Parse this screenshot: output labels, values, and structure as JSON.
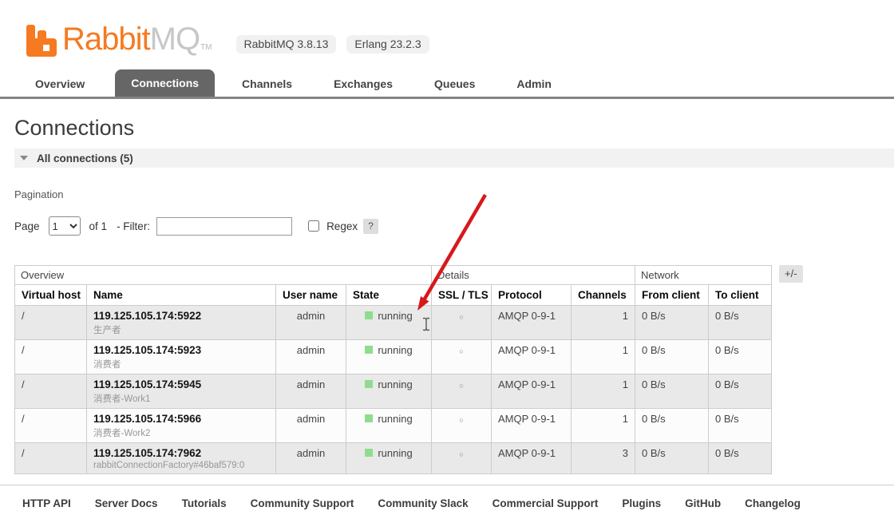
{
  "brand": {
    "name_primary": "Rabbit",
    "name_secondary": "MQ",
    "trademark": "TM",
    "version_badges": [
      "RabbitMQ 3.8.13",
      "Erlang 23.2.3"
    ]
  },
  "nav": {
    "tabs": [
      {
        "label": "Overview",
        "active": false
      },
      {
        "label": "Connections",
        "active": true
      },
      {
        "label": "Channels",
        "active": false
      },
      {
        "label": "Exchanges",
        "active": false
      },
      {
        "label": "Queues",
        "active": false
      },
      {
        "label": "Admin",
        "active": false
      }
    ]
  },
  "page": {
    "title": "Connections",
    "section_toggle": "All connections (5)",
    "pagination_heading": "Pagination",
    "page_label": "Page",
    "page_selected": "1",
    "of_label": "of 1",
    "filter_label": "- Filter:",
    "filter_value": "",
    "regex_label": "Regex",
    "regex_checked": false,
    "help_badge": "?",
    "columns_toggle": "+/-"
  },
  "table": {
    "group_headers": [
      "Overview",
      "Details",
      "Network"
    ],
    "columns": [
      "Virtual host",
      "Name",
      "User name",
      "State",
      "SSL / TLS",
      "Protocol",
      "Channels",
      "From client",
      "To client"
    ],
    "rows": [
      {
        "virtual_host": "/",
        "name": "119.125.105.174:5922",
        "client_label": "生产者",
        "user_name": "admin",
        "state": "running",
        "ssl_tls": "○",
        "protocol": "AMQP 0-9-1",
        "channels": "1",
        "from_client": "0 B/s",
        "to_client": "0 B/s"
      },
      {
        "virtual_host": "/",
        "name": "119.125.105.174:5923",
        "client_label": "消费者",
        "user_name": "admin",
        "state": "running",
        "ssl_tls": "○",
        "protocol": "AMQP 0-9-1",
        "channels": "1",
        "from_client": "0 B/s",
        "to_client": "0 B/s"
      },
      {
        "virtual_host": "/",
        "name": "119.125.105.174:5945",
        "client_label": "消费者-Work1",
        "user_name": "admin",
        "state": "running",
        "ssl_tls": "○",
        "protocol": "AMQP 0-9-1",
        "channels": "1",
        "from_client": "0 B/s",
        "to_client": "0 B/s"
      },
      {
        "virtual_host": "/",
        "name": "119.125.105.174:5966",
        "client_label": "消费者-Work2",
        "user_name": "admin",
        "state": "running",
        "ssl_tls": "○",
        "protocol": "AMQP 0-9-1",
        "channels": "1",
        "from_client": "0 B/s",
        "to_client": "0 B/s"
      },
      {
        "virtual_host": "/",
        "name": "119.125.105.174:7962",
        "client_label": "rabbitConnectionFactory#46baf579:0",
        "user_name": "admin",
        "state": "running",
        "ssl_tls": "○",
        "protocol": "AMQP 0-9-1",
        "channels": "3",
        "from_client": "0 B/s",
        "to_client": "0 B/s"
      }
    ]
  },
  "footer": {
    "links": [
      "HTTP API",
      "Server Docs",
      "Tutorials",
      "Community Support",
      "Community Slack",
      "Commercial Support",
      "Plugins",
      "GitHub",
      "Changelog"
    ]
  },
  "colors": {
    "brand_orange": "#f57a21",
    "brand_gray": "#c7c7c7",
    "active_tab_bg": "#666666",
    "running_green": "#8fdc8f",
    "annotation_arrow_red": "#d8181c"
  }
}
